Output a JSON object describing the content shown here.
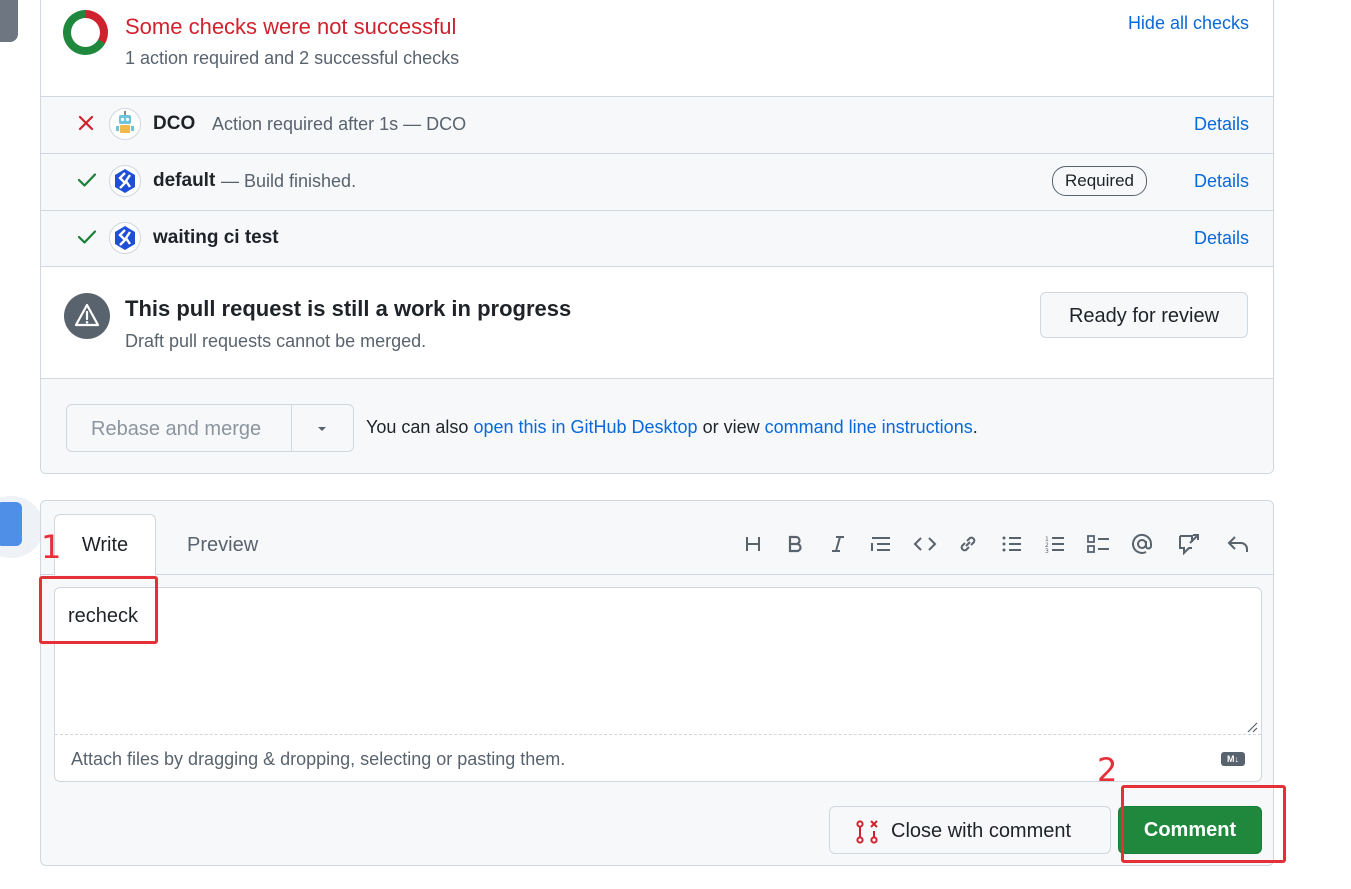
{
  "checks_summary": {
    "title": "Some checks were not successful",
    "subtitle": "1 action required and 2 successful checks",
    "hide_link": "Hide all checks"
  },
  "checks": [
    {
      "name": "DCO",
      "description": "Action required after 1s — DCO",
      "details": "Details",
      "status": "fail"
    },
    {
      "name": "default",
      "description": "— Build finished.",
      "details": "Details",
      "status": "success",
      "badge": "Required"
    },
    {
      "name": "waiting ci test",
      "description": "",
      "details": "Details",
      "status": "success"
    }
  ],
  "wip": {
    "title": "This pull request is still a work in progress",
    "subtitle": "Draft pull requests cannot be merged.",
    "ready_button": "Ready for review"
  },
  "merge": {
    "button_label": "Rebase and merge",
    "hint_prefix": "You can also",
    "link_desktop": "open this in GitHub Desktop",
    "hint_middle": "or view",
    "link_cli": "command line instructions",
    "hint_suffix": "."
  },
  "comment": {
    "tab_write": "Write",
    "tab_preview": "Preview",
    "value": "recheck",
    "attach_hint": "Attach files by dragging & dropping, selecting or pasting them.",
    "close_button": "Close with comment",
    "comment_button": "Comment"
  },
  "annotations": {
    "step1": "1",
    "step2": "2"
  },
  "colors": {
    "fail": "#cf222e",
    "success": "#1a7f37",
    "link": "#0969da",
    "primary_button": "#1f883d",
    "annotation": "#e5303a"
  }
}
